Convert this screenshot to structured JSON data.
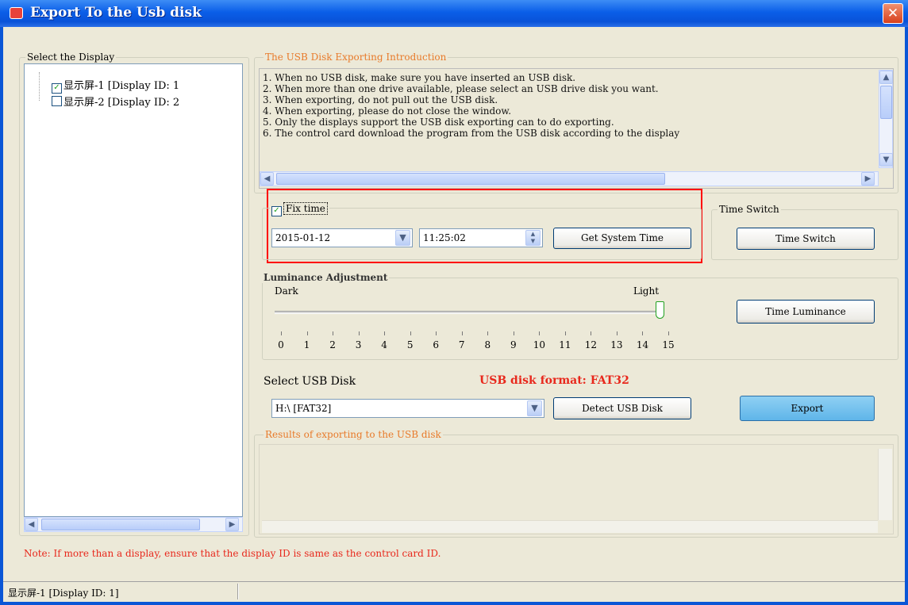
{
  "window": {
    "title": "Export To the Usb disk"
  },
  "display_panel": {
    "legend": "Select the Display",
    "items": [
      {
        "label": "显示屏-1 [Display ID: 1",
        "checked": true
      },
      {
        "label": "显示屏-2 [Display ID: 2",
        "checked": false
      }
    ]
  },
  "intro": {
    "legend": "The USB Disk Exporting Introduction",
    "lines": [
      "1. When no USB disk, make sure you have inserted an USB disk.",
      "2. When more than one drive available, please select an USB drive disk you want.",
      "3. When exporting, do not pull out the USB disk.",
      "4. When exporting, please do not close the window.",
      "5. Only the displays support the USB disk exporting can to do exporting.",
      "6. The control card download the program from the USB disk according to the display"
    ]
  },
  "fix_time": {
    "label": "Fix time",
    "checked": true,
    "date": "2015-01-12",
    "time": "11:25:02",
    "get_system_time_label": "Get System Time"
  },
  "time_switch": {
    "legend": "Time Switch",
    "button_label": "Time Switch"
  },
  "luminance": {
    "legend": "Luminance Adjustment",
    "dark_label": "Dark",
    "light_label": "Light",
    "value": 15,
    "scale": [
      "0",
      "1",
      "2",
      "3",
      "4",
      "5",
      "6",
      "7",
      "8",
      "9",
      "10",
      "11",
      "12",
      "13",
      "14",
      "15"
    ],
    "time_luminance_label": "Time Luminance"
  },
  "usb": {
    "select_label": "Select USB Disk",
    "format_note": "USB disk format: FAT32",
    "selected_disk": "H:\\ [FAT32]",
    "detect_label": "Detect USB Disk",
    "export_label": "Export"
  },
  "results": {
    "legend": "Results of exporting to the USB disk"
  },
  "note": "Note: If more than a display, ensure that the display ID is same as the control card ID.",
  "status": {
    "text": "显示屏-1 [Display ID: 1]"
  },
  "icons": [
    "close-icon",
    "app-icon",
    "scroll-left-icon",
    "scroll-right-icon",
    "scroll-up-icon",
    "scroll-down-icon",
    "dropdown-arrow-icon",
    "spin-icon",
    "checkmark-icon"
  ],
  "colors": {
    "titlebar": "#0a5ee8",
    "accent_orange": "#e87a2a",
    "note_red": "#e8281c",
    "highlight_box": "#ff0000"
  }
}
